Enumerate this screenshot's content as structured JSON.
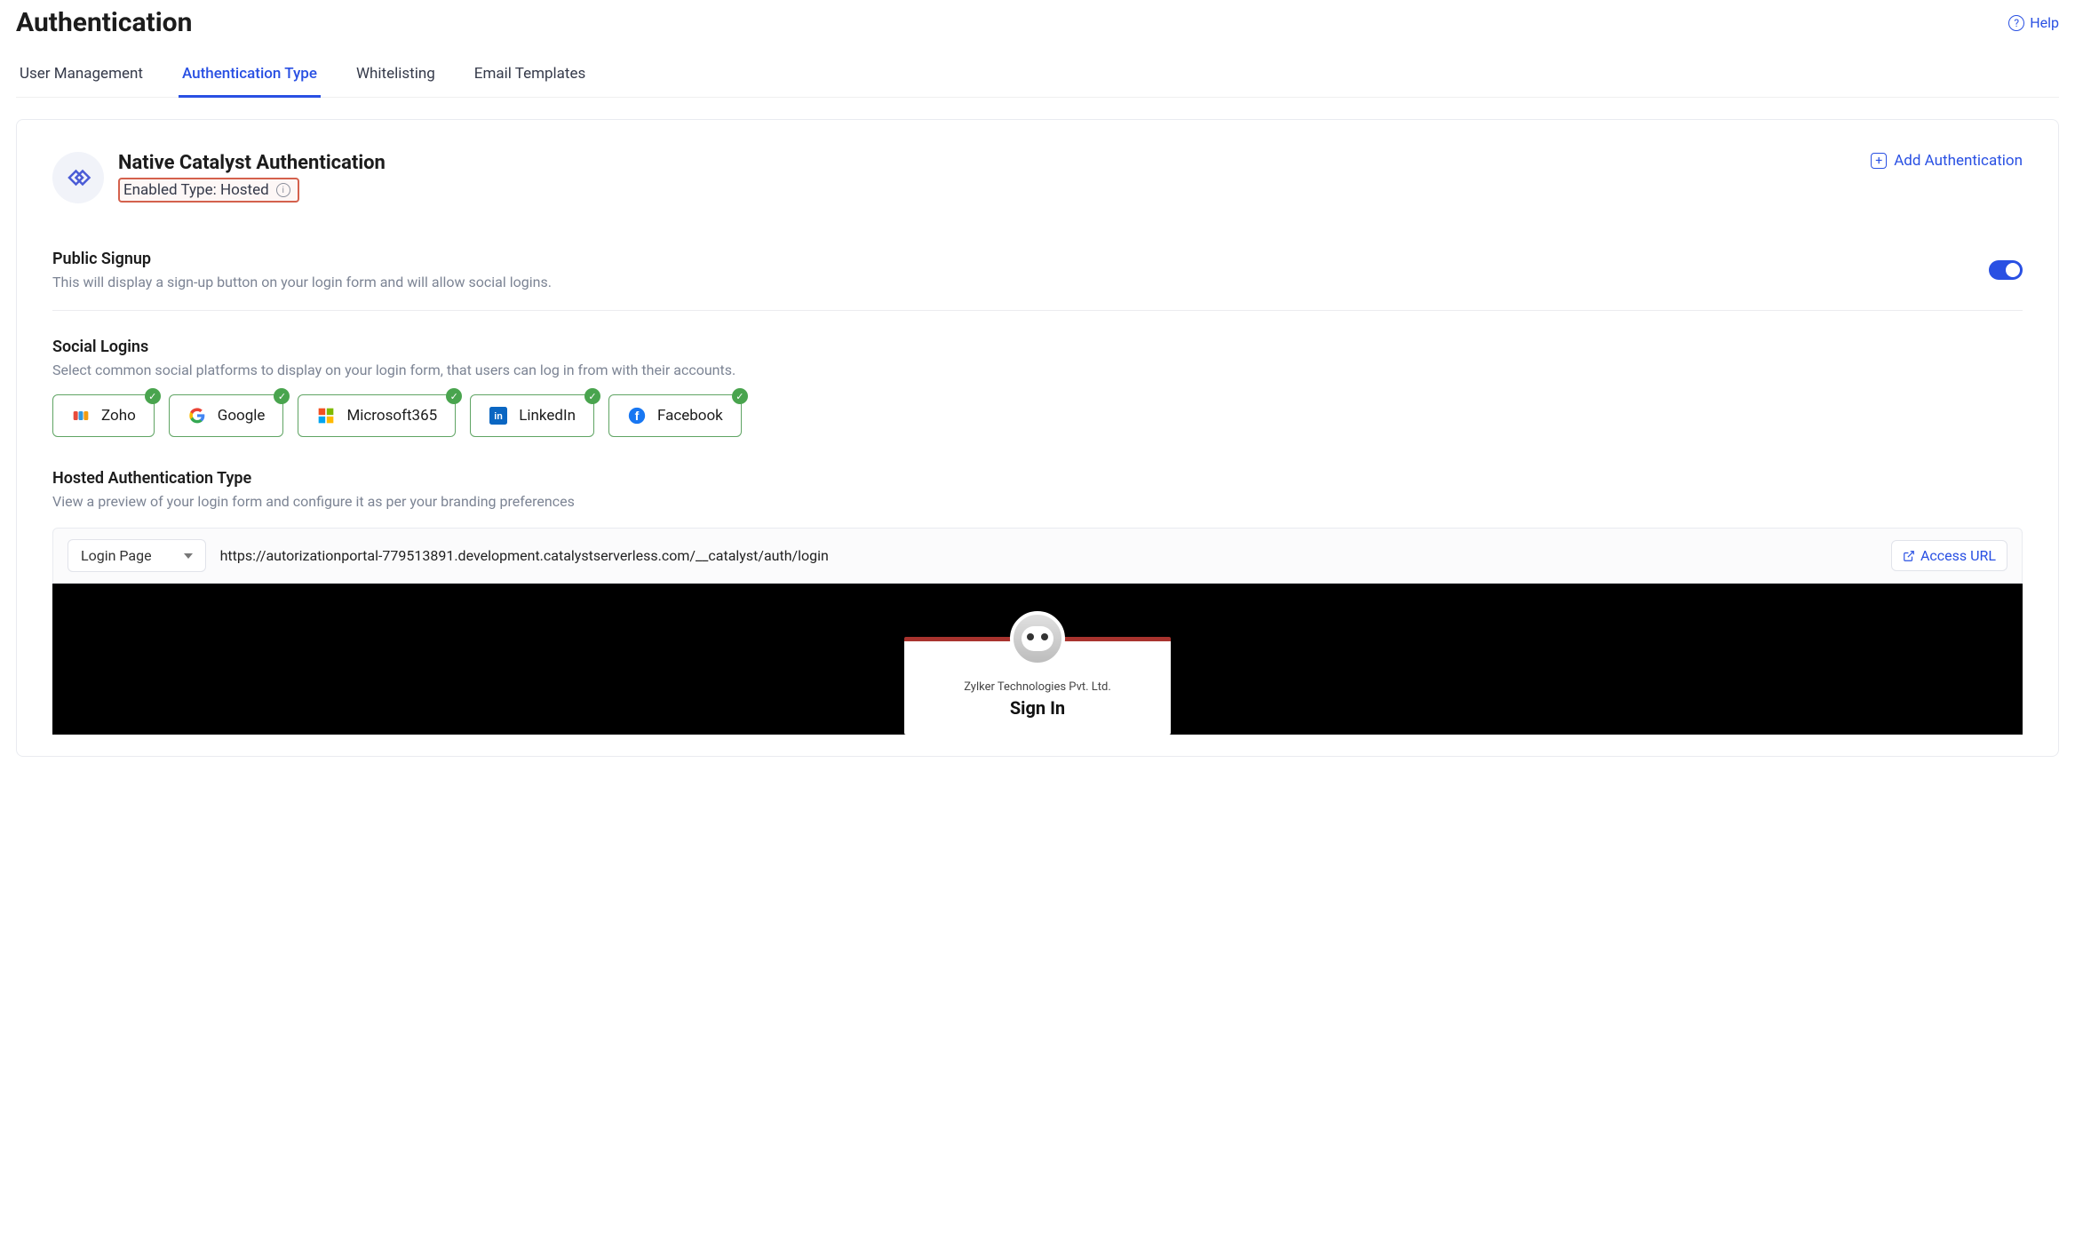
{
  "header": {
    "title": "Authentication",
    "help_label": "Help"
  },
  "tabs": [
    {
      "label": "User Management",
      "active": false
    },
    {
      "label": "Authentication Type",
      "active": true
    },
    {
      "label": "Whitelisting",
      "active": false
    },
    {
      "label": "Email Templates",
      "active": false
    }
  ],
  "auth": {
    "section_title": "Native Catalyst Authentication",
    "enabled_type_label": "Enabled Type: Hosted",
    "add_auth_label": "Add Authentication"
  },
  "public_signup": {
    "title": "Public Signup",
    "desc": "This will display a sign-up button on your login form and will allow social logins.",
    "enabled": true
  },
  "social": {
    "title": "Social Logins",
    "desc": "Select common social platforms to display on your login form, that users can log in from with their accounts.",
    "providers": [
      {
        "name": "Zoho"
      },
      {
        "name": "Google"
      },
      {
        "name": "Microsoft365"
      },
      {
        "name": "LinkedIn"
      },
      {
        "name": "Facebook"
      }
    ]
  },
  "hosted": {
    "title": "Hosted Authentication Type",
    "desc": "View a preview of your login form and configure it as per your branding preferences",
    "page_select_label": "Login Page",
    "url": "https://autorizationportal-779513891.development.catalystserverless.com/__catalyst/auth/login",
    "access_url_label": "Access URL"
  },
  "preview": {
    "company": "Zylker Technologies Pvt. Ltd.",
    "signin_title": "Sign In"
  }
}
